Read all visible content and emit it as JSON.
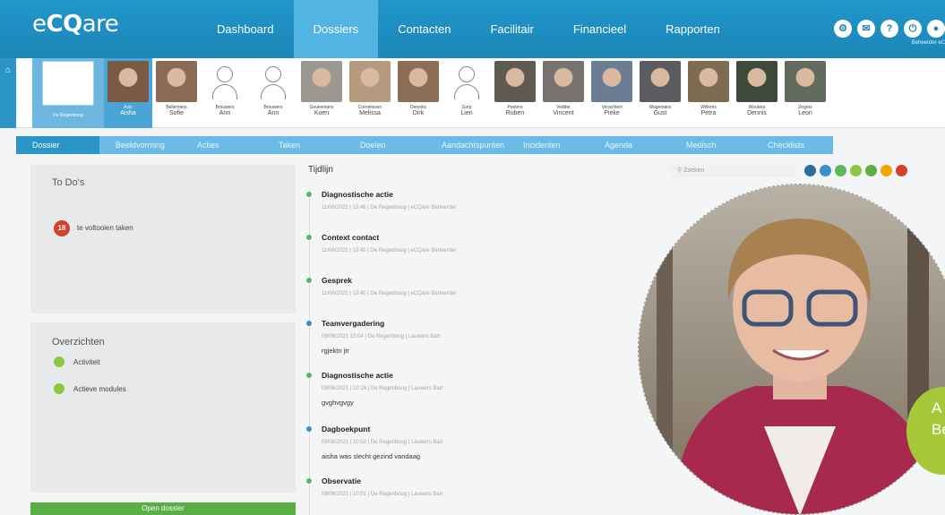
{
  "app": {
    "logo_prefix": "e",
    "logo_bold": "CQ",
    "logo_suffix": "are"
  },
  "nav": [
    "Dashboard",
    "Dossiers",
    "Contacten",
    "Facilitair",
    "Financieel",
    "Rapporten"
  ],
  "nav_active": 1,
  "top_icons": [
    "settings-icon",
    "mail-icon",
    "help-icon",
    "power-icon",
    "user-icon"
  ],
  "user_label": "Beheerder eC",
  "strip_home_icon": "home-icon",
  "organisation": {
    "label": "De Regenboog",
    "icon": "rainbow-logo-icon"
  },
  "clients": [
    {
      "last": "Aziz",
      "first": "Aisha",
      "photo": true,
      "color": "#7a5a44",
      "active": true
    },
    {
      "last": "Bellemans",
      "first": "Sofie",
      "photo": true,
      "color": "#8a6a55"
    },
    {
      "last": "Brouwers",
      "first": "Ann",
      "photo": false
    },
    {
      "last": "Brouwers",
      "first": "Ann",
      "photo": false
    },
    {
      "last": "Geukemans",
      "first": "Koen",
      "photo": true,
      "color": "#9a9890"
    },
    {
      "last": "Cornelissen",
      "first": "Melissa",
      "photo": true,
      "color": "#b59b7d"
    },
    {
      "last": "Demolis",
      "first": "Dirk",
      "photo": true,
      "color": "#8c6e57"
    },
    {
      "last": "Gorp",
      "first": "Lien",
      "photo": false
    },
    {
      "last": "Peeters",
      "first": "Ruben",
      "photo": true,
      "color": "#5f5a52"
    },
    {
      "last": "Vedder",
      "first": "Vincent",
      "photo": true,
      "color": "#777270"
    },
    {
      "last": "Verachtert",
      "first": "Pieke",
      "photo": true,
      "color": "#6a7d94"
    },
    {
      "last": "Wagemans",
      "first": "Gust",
      "photo": true,
      "color": "#5c5b60"
    },
    {
      "last": "Willems",
      "first": "Petra",
      "photo": true,
      "color": "#7d6b52"
    },
    {
      "last": "Wouters",
      "first": "Dennis",
      "photo": true,
      "color": "#3e4a3a"
    },
    {
      "last": "Zegers",
      "first": "Leon",
      "photo": true,
      "color": "#606a5e"
    }
  ],
  "tabs": [
    "Dossier",
    "Beeldvorming",
    "Acties",
    "Taken",
    "Doelen",
    "Aandachtspunten",
    "Incidenten",
    "Agenda",
    "Medisch",
    "Checklists"
  ],
  "tabs_active": 0,
  "todo": {
    "title": "To Do's",
    "count": "18",
    "label": "te voltooien taken"
  },
  "overview": {
    "title": "Overzichten",
    "items": [
      "Activiteit",
      "Actieve modules"
    ]
  },
  "open_button": "Open dossier",
  "timeline": {
    "title": "Tijdlijn",
    "search_placeholder": "Zoeken",
    "filter_colors": [
      "#2b6e9e",
      "#3a8fc9",
      "#5cb85c",
      "#8dc63f",
      "#5aaf44",
      "#f0a500",
      "#d5402c"
    ],
    "items": [
      {
        "title": "Diagnostische actie",
        "meta": "11/06/2021 | 13:46 | De Regenboog | eCQare Beheerder",
        "body": "",
        "dot": "green"
      },
      {
        "title": "Context contact",
        "meta": "11/06/2021 | 13:40 | De Regenboog | eCQare Beheerder",
        "body": "",
        "dot": "green"
      },
      {
        "title": "Gesprek",
        "meta": "11/06/2021 | 13:40 | De Regenboog | eCQare Beheerder",
        "body": "",
        "dot": "green"
      },
      {
        "title": "Teamvergadering",
        "meta": "09/06/2021 15:04 | De Regenboog | Lauwers Bart",
        "body": "rgjektn jtr",
        "dot": "blue"
      },
      {
        "title": "Diagnostische actie",
        "meta": "09/06/2021 | 10:16 | De Regenboog | Lauwers Bart",
        "body": "gvghvgvgy",
        "dot": "green"
      },
      {
        "title": "Dagboekpunt",
        "meta": "09/06/2021 | 10:02 | De Regenboog | Lauwers Bart",
        "body": "aisha was slecht gezind vandaag",
        "dot": "blue"
      },
      {
        "title": "Observatie",
        "meta": "09/06/2021 | 10:01 | De Regenboog | Lauwers Bart",
        "body": "",
        "dot": "green"
      }
    ]
  },
  "badge_text": {
    "line1": "A",
    "line2": "Be"
  }
}
